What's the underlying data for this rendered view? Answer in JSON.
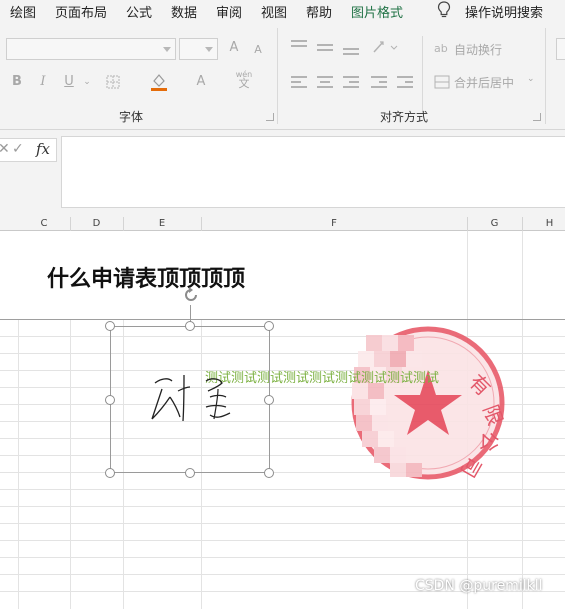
{
  "menu": {
    "items": [
      "绘图",
      "页面布局",
      "公式",
      "数据",
      "审阅",
      "视图",
      "帮助",
      "图片格式"
    ],
    "active_index": 7,
    "search_label": "操作说明搜索",
    "accent_color": "#217346"
  },
  "ribbon": {
    "font_group": {
      "label": "字体",
      "bold": "B",
      "italic": "I",
      "underline": "U",
      "font_color_letter": "A",
      "phonetic_top": "wén",
      "phonetic_bottom": "文",
      "grow_font": "A",
      "shrink_font": "A",
      "font_color_bar": "#e46c0a"
    },
    "align_group": {
      "label": "对齐方式",
      "wrap_text": "自动换行",
      "merge_center": "合并后居中"
    }
  },
  "formula_bar": {
    "fx_label": "fx",
    "cancel": "✕",
    "enter": "✓",
    "value": ""
  },
  "columns": [
    "C",
    "D",
    "E",
    "F",
    "G",
    "H"
  ],
  "sheet": {
    "title": "什么申请表顶顶顶顶",
    "overlay_text": "测试测试测试测试测试测试测试测试测试",
    "signature": "刘 金"
  },
  "watermark": "CSDN @puremilkll"
}
